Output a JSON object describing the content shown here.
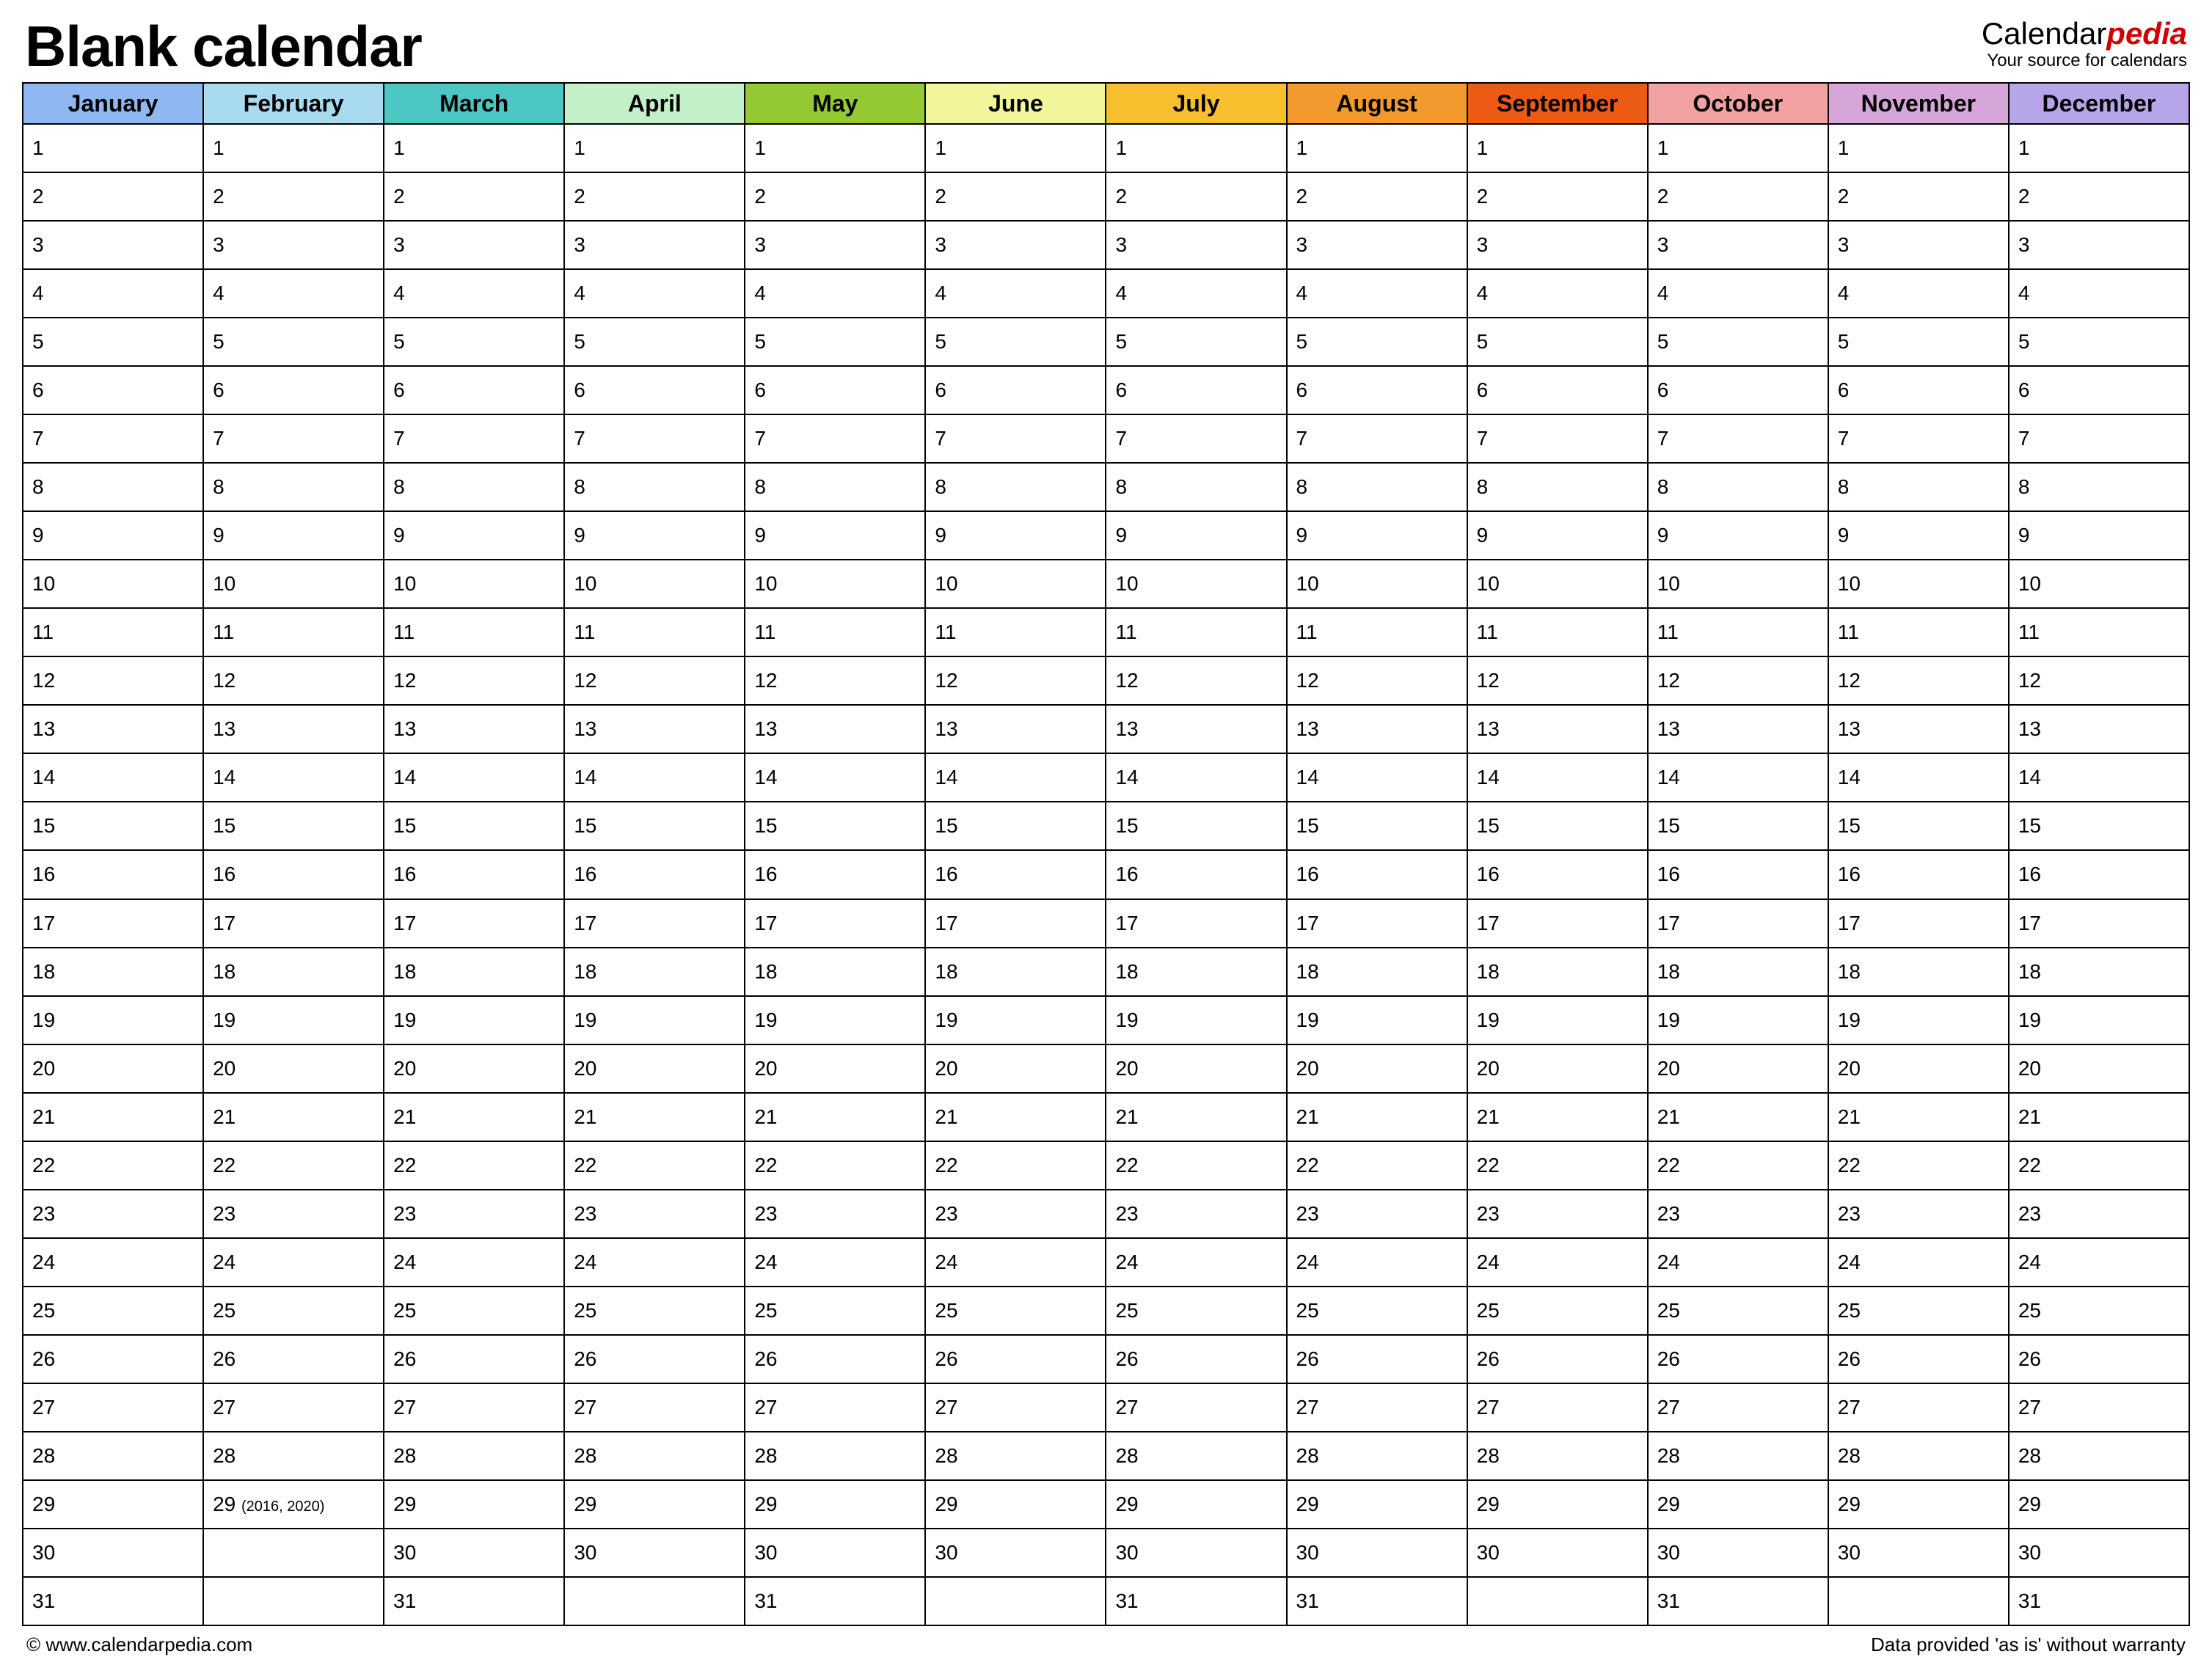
{
  "header": {
    "title": "Blank calendar",
    "brand_main": "Calendar",
    "brand_accent": "pedia",
    "brand_sub": "Your source for calendars"
  },
  "months": [
    {
      "name": "January",
      "color": "#8fb7f2",
      "days": 31
    },
    {
      "name": "February",
      "color": "#a8dbef",
      "days": 29,
      "special_day": 29,
      "special_note": "(2016, 2020)"
    },
    {
      "name": "March",
      "color": "#4cc6c2",
      "days": 31
    },
    {
      "name": "April",
      "color": "#c3f0c8",
      "days": 30
    },
    {
      "name": "May",
      "color": "#95c933",
      "days": 31
    },
    {
      "name": "June",
      "color": "#f2f59b",
      "days": 30
    },
    {
      "name": "July",
      "color": "#f8c02f",
      "days": 31
    },
    {
      "name": "August",
      "color": "#f29a2e",
      "days": 31
    },
    {
      "name": "September",
      "color": "#ec5a13",
      "days": 30
    },
    {
      "name": "October",
      "color": "#f2a2a2",
      "days": 31
    },
    {
      "name": "November",
      "color": "#d7a6d9",
      "days": 30
    },
    {
      "name": "December",
      "color": "#b6a6e9",
      "days": 31
    }
  ],
  "max_rows": 31,
  "footer": {
    "left": "© www.calendarpedia.com",
    "right": "Data provided 'as is' without warranty"
  }
}
